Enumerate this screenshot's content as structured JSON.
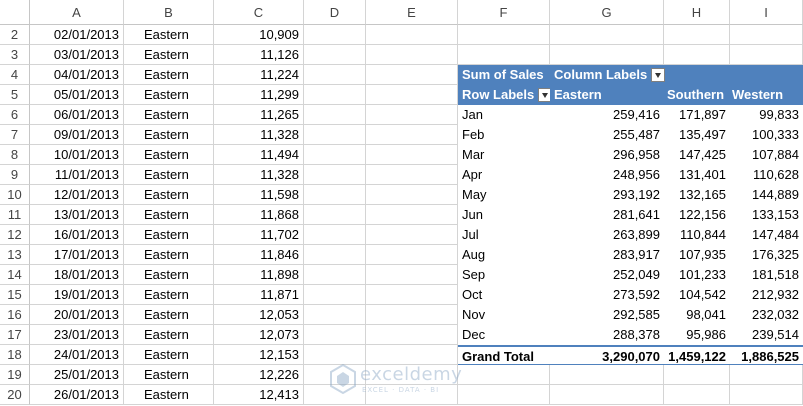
{
  "columns": [
    "A",
    "B",
    "C",
    "D",
    "E",
    "F",
    "G",
    "H",
    "I"
  ],
  "rows": [
    {
      "num": "2",
      "date": "02/01/2013",
      "region": "Eastern",
      "sales": "10,909"
    },
    {
      "num": "3",
      "date": "03/01/2013",
      "region": "Eastern",
      "sales": "11,126"
    },
    {
      "num": "4",
      "date": "04/01/2013",
      "region": "Eastern",
      "sales": "11,224"
    },
    {
      "num": "5",
      "date": "05/01/2013",
      "region": "Eastern",
      "sales": "11,299"
    },
    {
      "num": "6",
      "date": "06/01/2013",
      "region": "Eastern",
      "sales": "11,265"
    },
    {
      "num": "7",
      "date": "09/01/2013",
      "region": "Eastern",
      "sales": "11,328"
    },
    {
      "num": "8",
      "date": "10/01/2013",
      "region": "Eastern",
      "sales": "11,494"
    },
    {
      "num": "9",
      "date": "11/01/2013",
      "region": "Eastern",
      "sales": "11,328"
    },
    {
      "num": "10",
      "date": "12/01/2013",
      "region": "Eastern",
      "sales": "11,598"
    },
    {
      "num": "11",
      "date": "13/01/2013",
      "region": "Eastern",
      "sales": "11,868"
    },
    {
      "num": "12",
      "date": "16/01/2013",
      "region": "Eastern",
      "sales": "11,702"
    },
    {
      "num": "13",
      "date": "17/01/2013",
      "region": "Eastern",
      "sales": "11,846"
    },
    {
      "num": "14",
      "date": "18/01/2013",
      "region": "Eastern",
      "sales": "11,898"
    },
    {
      "num": "15",
      "date": "19/01/2013",
      "region": "Eastern",
      "sales": "11,871"
    },
    {
      "num": "16",
      "date": "20/01/2013",
      "region": "Eastern",
      "sales": "12,053"
    },
    {
      "num": "17",
      "date": "23/01/2013",
      "region": "Eastern",
      "sales": "12,073"
    },
    {
      "num": "18",
      "date": "24/01/2013",
      "region": "Eastern",
      "sales": "12,153"
    },
    {
      "num": "19",
      "date": "25/01/2013",
      "region": "Eastern",
      "sales": "12,226"
    },
    {
      "num": "20",
      "date": "26/01/2013",
      "region": "Eastern",
      "sales": "12,413"
    }
  ],
  "pivot": {
    "values_label": "Sum of Sales",
    "column_labels": "Column Labels",
    "row_labels": "Row Labels",
    "col_headers": [
      "Eastern",
      "Southern",
      "Western"
    ],
    "rows": [
      {
        "label": "Jan",
        "values": [
          "259,416",
          "171,897",
          "99,833"
        ]
      },
      {
        "label": "Feb",
        "values": [
          "255,487",
          "135,497",
          "100,333"
        ]
      },
      {
        "label": "Mar",
        "values": [
          "296,958",
          "147,425",
          "107,884"
        ]
      },
      {
        "label": "Apr",
        "values": [
          "248,956",
          "131,401",
          "110,628"
        ]
      },
      {
        "label": "May",
        "values": [
          "293,192",
          "132,165",
          "144,889"
        ]
      },
      {
        "label": "Jun",
        "values": [
          "281,641",
          "122,156",
          "133,153"
        ]
      },
      {
        "label": "Jul",
        "values": [
          "263,899",
          "110,844",
          "147,484"
        ]
      },
      {
        "label": "Aug",
        "values": [
          "283,917",
          "107,935",
          "176,325"
        ]
      },
      {
        "label": "Sep",
        "values": [
          "252,049",
          "101,233",
          "181,518"
        ]
      },
      {
        "label": "Oct",
        "values": [
          "273,592",
          "104,542",
          "212,932"
        ]
      },
      {
        "label": "Nov",
        "values": [
          "292,585",
          "98,041",
          "232,032"
        ]
      },
      {
        "label": "Dec",
        "values": [
          "288,378",
          "95,986",
          "239,514"
        ]
      }
    ],
    "grand_total": {
      "label": "Grand Total",
      "values": [
        "3,290,070",
        "1,459,122",
        "1,886,525"
      ]
    }
  },
  "watermark": {
    "name": "exceldemy",
    "tagline": "EXCEL · DATA · BI"
  },
  "colors": {
    "pivot_header": "#4f81bd",
    "grid": "#d4d4d4"
  }
}
